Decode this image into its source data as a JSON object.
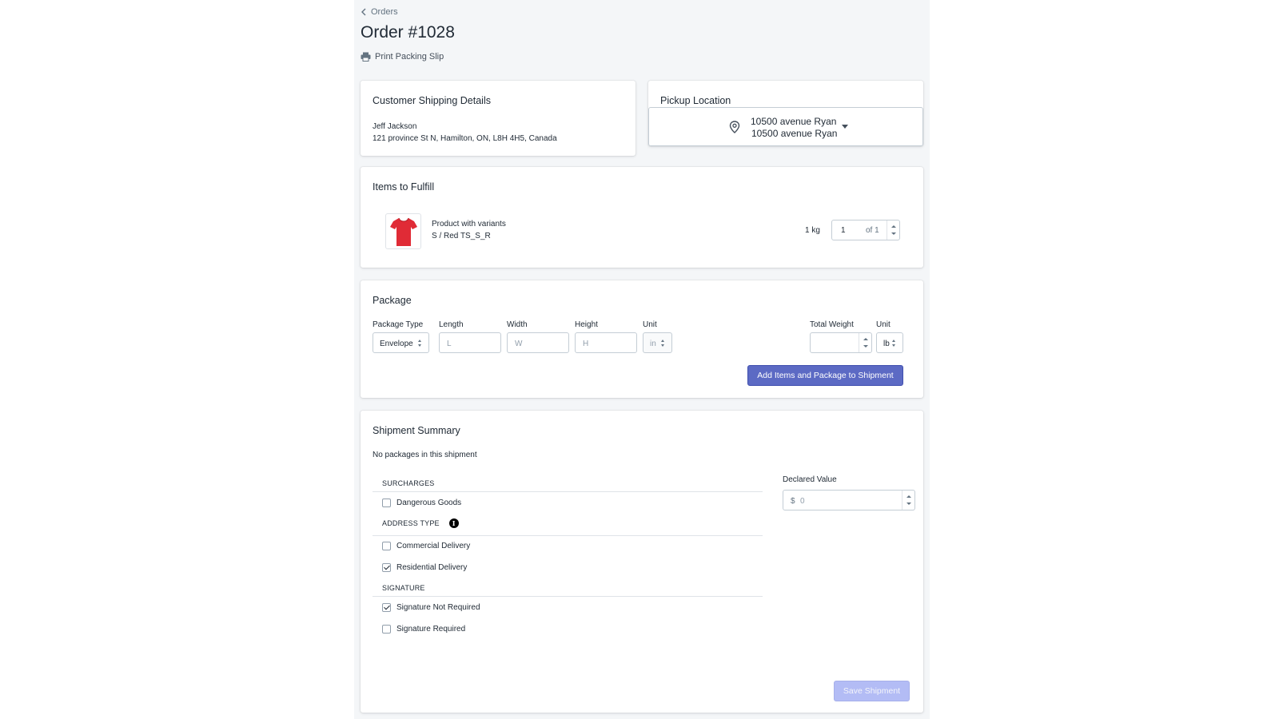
{
  "breadcrumb": {
    "label": "Orders"
  },
  "page": {
    "title": "Order #1028",
    "print_label": "Print Packing Slip"
  },
  "shipping": {
    "title": "Customer Shipping Details",
    "name": "Jeff Jackson",
    "address": "121 province St N, Hamilton, ON, L8H 4H5, Canada"
  },
  "pickup": {
    "title": "Pickup Location",
    "line1": "10500 avenue Ryan",
    "line2": "10500 avenue Ryan"
  },
  "items": {
    "title": "Items to Fulfill",
    "product_name": "Product with variants",
    "variant": "S / Red TS_S_R",
    "weight": "1 kg",
    "quantity": "1",
    "quantity_of": "of 1",
    "thumb_color": "#e02b36"
  },
  "package": {
    "title": "Package",
    "type_label": "Package Type",
    "type_value": "Envelope",
    "length_label": "Length",
    "length_placeholder": "L",
    "width_label": "Width",
    "width_placeholder": "W",
    "height_label": "Height",
    "height_placeholder": "H",
    "unit_label": "Unit",
    "unit_value": "in",
    "total_weight_label": "Total Weight",
    "total_weight_value": "",
    "weight_unit_label": "Unit",
    "weight_unit_value": "lb",
    "add_button": "Add Items and Package to Shipment"
  },
  "summary": {
    "title": "Shipment Summary",
    "no_packages": "No packages in this shipment",
    "surcharges_head": "SURCHARGES",
    "dangerous_goods": "Dangerous Goods",
    "address_type_head": "ADDRESS TYPE",
    "commercial": "Commercial Delivery",
    "residential": "Residential Delivery",
    "signature_head": "SIGNATURE",
    "sig_not_required": "Signature Not Required",
    "sig_required": "Signature Required",
    "declared_label": "Declared Value",
    "declared_currency": "$",
    "declared_value": "0",
    "save_button": "Save Shipment"
  },
  "colors": {
    "primary": "#5c6ac4",
    "primary_disabled": "#b3bcf5",
    "background": "#f4f6f8"
  },
  "icons": {
    "back": "chevron-left-icon",
    "print": "printer-icon",
    "pin": "map-pin-icon",
    "info": "info-icon"
  }
}
